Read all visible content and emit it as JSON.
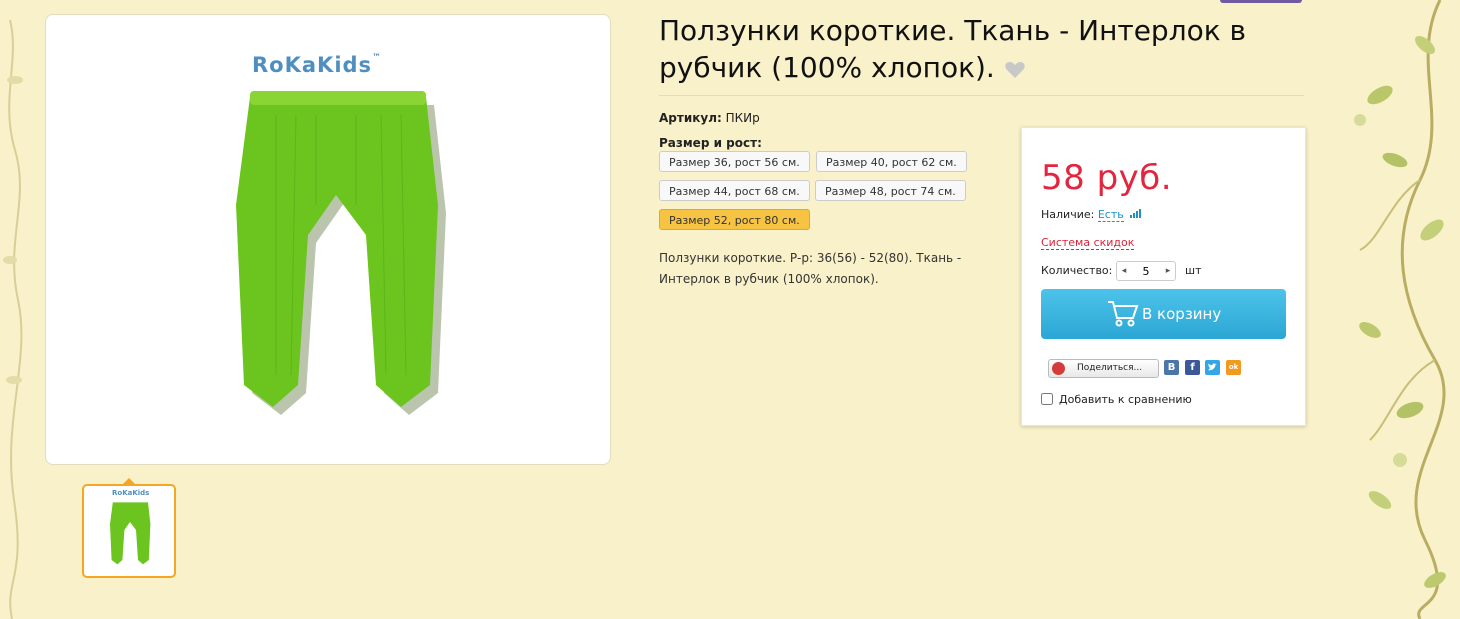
{
  "product": {
    "title": "Ползунки короткие. Ткань - Интерлок в рубчик (100% хлопок).",
    "sku_label": "Артикул:",
    "sku_value": "ПКИр",
    "brand_logo_text": "RoKaKids",
    "size_label": "Размер и рост:",
    "sizes": [
      "Размер 36, рост 56 см.",
      "Размер 40, рост 62 см.",
      "Размер 44, рост 68 см.",
      "Размер 48, рост 74 см.",
      "Размер 52, рост 80 см."
    ],
    "selected_size": "Размер 52, рост 80 см.",
    "description": "Ползунки короткие. Р-р: 36(56) - 52(80). Ткань - Интерлок в рубчик (100% хлопок)."
  },
  "purchase": {
    "price": "58 руб.",
    "availability_label": "Наличие:",
    "availability_value": "Есть",
    "discount_link": "Система скидок",
    "quantity_label": "Количество:",
    "quantity_value": "5",
    "quantity_unit": "шт",
    "cart_button_label": "В корзину",
    "share_label": "Поделиться...",
    "social_vk": "В",
    "social_fb": "f",
    "social_ok": "ok",
    "compare_label": "Добавить к сравнению"
  },
  "colors": {
    "page_background": "#f9f1c9",
    "price": "#e2263f",
    "cart_button": "#2ba6d4",
    "selected_size": "#f7c342",
    "link": "#1a93c6",
    "thumb_border": "#f5a623",
    "product_green": "#6cc51e"
  },
  "icons": {
    "favorite": "heart-icon",
    "availability": "signal-bars-icon",
    "cart": "cart-icon",
    "share": "share-icon",
    "social": [
      "vk-icon",
      "facebook-icon",
      "twitter-icon",
      "odnoklassniki-icon"
    ]
  }
}
